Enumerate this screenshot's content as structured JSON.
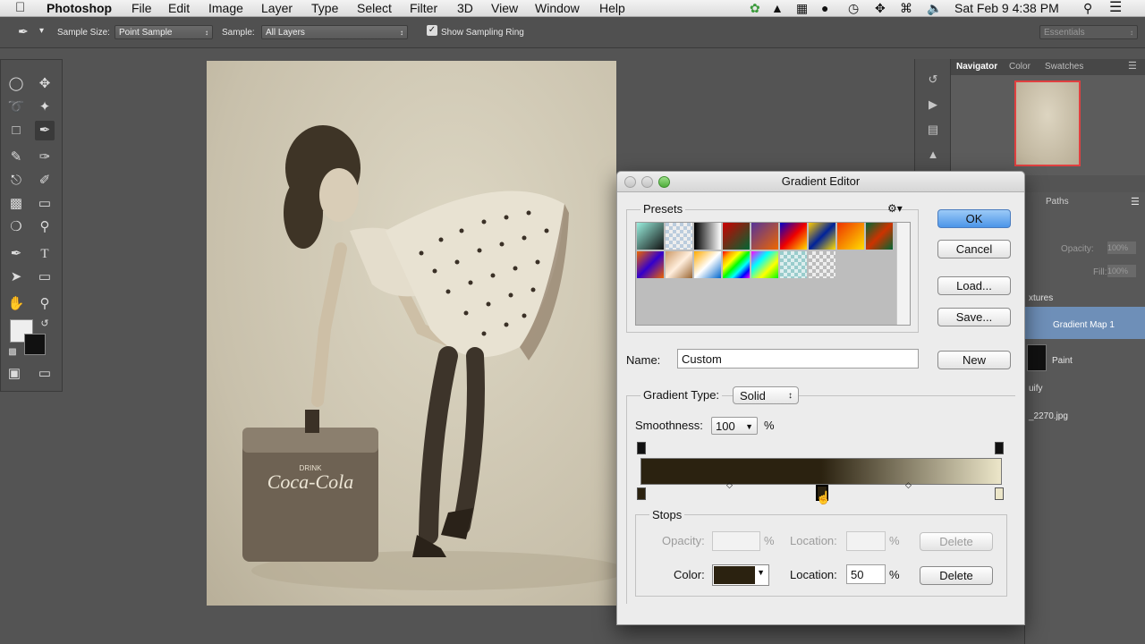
{
  "menubar": {
    "apple": "",
    "app": "Photoshop",
    "items": [
      "File",
      "Edit",
      "Image",
      "Layer",
      "Type",
      "Select",
      "Filter",
      "3D",
      "View",
      "Window",
      "Help"
    ],
    "clock": "Sat Feb 9  4:38 PM"
  },
  "options": {
    "sample_size_label": "Sample Size:",
    "sample_size_value": "Point Sample",
    "sample_label": "Sample:",
    "sample_value": "All Layers",
    "show_ring_label": "Show Sampling Ring",
    "show_ring_checked": true,
    "workspace": "Essentials"
  },
  "panels": {
    "tabs": [
      "Navigator",
      "Color",
      "Swatches"
    ],
    "layers_tab": "Paths",
    "opacity_label": "Opacity:",
    "opacity_value": "100%",
    "fill_label": "Fill:",
    "fill_value": "100%",
    "group_label": "xtures",
    "layers": [
      "Gradient Map 1",
      "Paint"
    ],
    "liquify": "uify",
    "file_layer": "_2270.jpg"
  },
  "document": {
    "cooler_text_small": "DRINK",
    "cooler_text": "Coca-Cola"
  },
  "dialog": {
    "title": "Gradient Editor",
    "presets_label": "Presets",
    "ok": "OK",
    "cancel": "Cancel",
    "load": "Load...",
    "save": "Save...",
    "new": "New",
    "name_label": "Name:",
    "name_value": "Custom",
    "gradient_type_label": "Gradient Type:",
    "gradient_type_value": "Solid",
    "smoothness_label": "Smoothness:",
    "smoothness_value": "100",
    "percent": "%",
    "stops_label": "Stops",
    "opacity_label": "Opacity:",
    "opacity_value": "",
    "location_label": "Location:",
    "opacity_location_value": "",
    "delete": "Delete",
    "color_label": "Color:",
    "color_location_value": "50",
    "stop_color": "#2b2210",
    "gradient_start": "#2b2210",
    "gradient_end": "#ece6c9"
  }
}
